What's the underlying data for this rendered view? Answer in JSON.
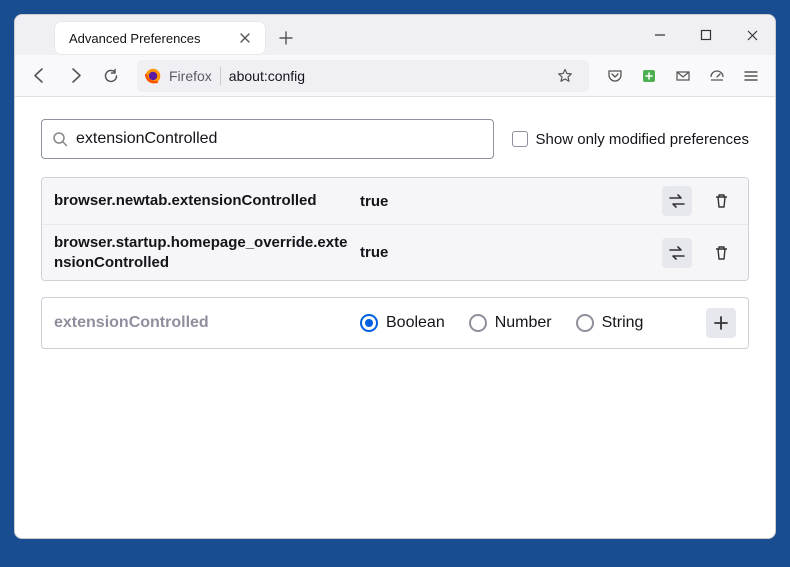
{
  "window": {
    "tab_title": "Advanced Preferences",
    "urlbar_host": "Firefox",
    "urlbar_path": "about:config"
  },
  "search": {
    "value": "extensionControlled",
    "modified_label": "Show only modified preferences"
  },
  "prefs": [
    {
      "name": "browser.newtab.extensionControlled",
      "value": "true"
    },
    {
      "name": "browser.startup.homepage_override.extensionControlled",
      "value": "true"
    }
  ],
  "new_pref": {
    "name": "extensionControlled",
    "types": [
      "Boolean",
      "Number",
      "String"
    ],
    "selected": "Boolean"
  }
}
